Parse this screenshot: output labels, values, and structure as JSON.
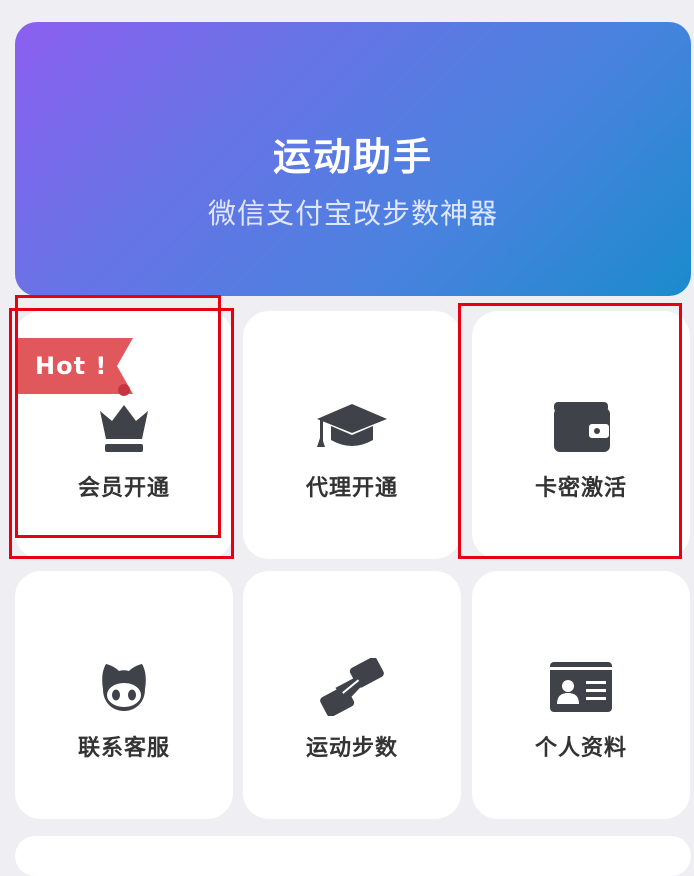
{
  "banner": {
    "title": "运动助手",
    "subtitle": "微信支付宝改步数神器"
  },
  "badge": {
    "text": "Hot !"
  },
  "menu": [
    {
      "label": "会员开通",
      "icon": "crown-icon"
    },
    {
      "label": "代理开通",
      "icon": "graduation-cap-icon"
    },
    {
      "label": "卡密激活",
      "icon": "wallet-icon"
    },
    {
      "label": "联系客服",
      "icon": "github-octocat-icon"
    },
    {
      "label": "运动步数",
      "icon": "handshake-icon"
    },
    {
      "label": "个人资料",
      "icon": "id-card-icon"
    }
  ],
  "colors": {
    "background": "#efeef3",
    "gradient_start": "#8c5ff0",
    "gradient_end": "#1b8bcc",
    "icon": "#3f4248",
    "hot_badge": "#e0575c",
    "highlight_box": "#e60012"
  }
}
